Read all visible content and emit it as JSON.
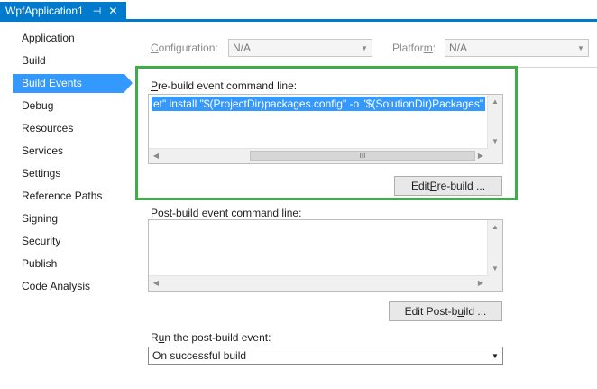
{
  "tab": {
    "title": "WpfApplication1",
    "pin_glyph": "⊣",
    "close_glyph": "✕"
  },
  "nav": {
    "items": [
      {
        "label": "Application"
      },
      {
        "label": "Build"
      },
      {
        "label": "Build Events",
        "active": true
      },
      {
        "label": "Debug"
      },
      {
        "label": "Resources"
      },
      {
        "label": "Services"
      },
      {
        "label": "Settings"
      },
      {
        "label": "Reference Paths"
      },
      {
        "label": "Signing"
      },
      {
        "label": "Security"
      },
      {
        "label": "Publish"
      },
      {
        "label": "Code Analysis"
      }
    ]
  },
  "config_bar": {
    "configuration_label": "Configuration:",
    "configuration_value": "N/A",
    "platform_label": "Platform:",
    "platform_value": "N/A"
  },
  "prebuild": {
    "label": "Pre-build event command line:",
    "command": "et\" install \"$(ProjectDir)packages.config\" -o \"$(SolutionDir)Packages\"",
    "edit_button": "Edit Pre-build ..."
  },
  "postbuild": {
    "label": "Post-build event command line:",
    "command": "",
    "edit_button": "Edit Post-build ..."
  },
  "run_post_build": {
    "label": "Run the post-build event:",
    "selected": "On successful build"
  },
  "glyphs": {
    "up": "▲",
    "down": "▼",
    "left": "◀",
    "right": "▶",
    "grip": "III",
    "dropdown": "▼"
  },
  "colors": {
    "accent": "#007acc",
    "selection": "#3399ff",
    "highlight_border": "#3fae49"
  }
}
